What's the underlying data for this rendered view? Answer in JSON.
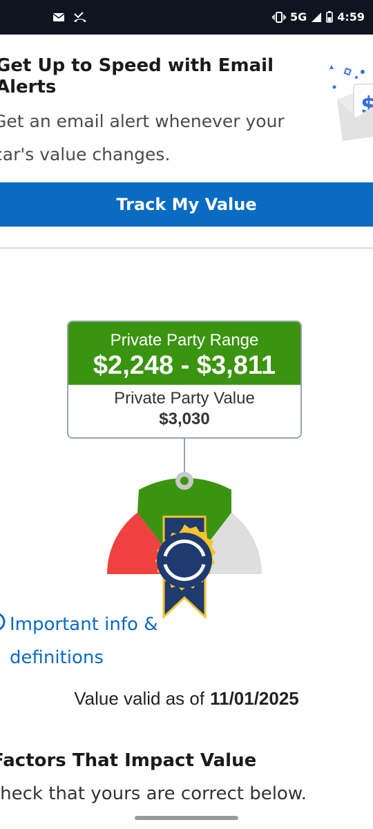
{
  "status_bar": {
    "network": "5G",
    "time": "4:59",
    "icons": [
      "mail-icon",
      "missed-call-icon",
      "vibrate-icon",
      "signal-icon",
      "battery-icon"
    ]
  },
  "promo": {
    "title": "Get Up to Speed with Email Alerts",
    "body": "Get an email alert whenever your car's value changes.",
    "button_label": "Track My Value"
  },
  "valuation": {
    "range_label": "Private Party Range",
    "range_value": "$2,248 - $3,811",
    "value_label": "Private Party Value",
    "value": "$3,030"
  },
  "info_link": {
    "label": "Important info & definitions"
  },
  "validity": {
    "label": "Value valid as of",
    "date": "11/01/2025"
  },
  "factors": {
    "title": "Factors That Impact Value",
    "subtitle": "Check that yours are correct below."
  },
  "colors": {
    "accent_blue": "#0a6bc2",
    "range_green": "#3a9410",
    "gauge_red": "#f04141",
    "gauge_gray": "#dedede",
    "ribbon_navy": "#1f3a6e",
    "ribbon_gold": "#f5c330"
  }
}
